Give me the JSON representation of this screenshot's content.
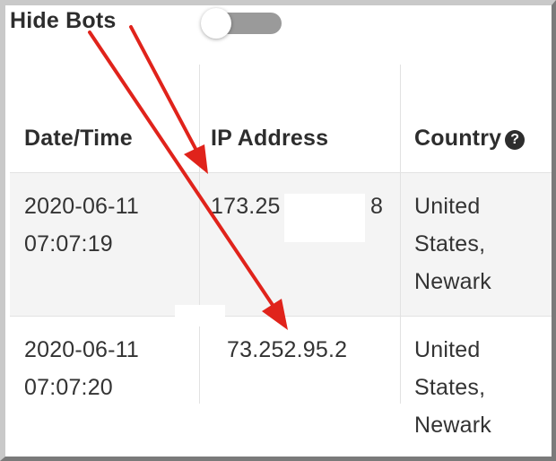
{
  "filter": {
    "label": "Hide Bots",
    "toggle_state": "off"
  },
  "table": {
    "columns": [
      "Date/Time",
      "IP Address",
      "Country"
    ],
    "country_help_icon": "question-circle-icon",
    "rows": [
      {
        "date": "2020-06-11",
        "time": "07:07:19",
        "ip_start": "173.25",
        "ip_end": "8",
        "country_lines": [
          "United",
          "States,",
          "Newark"
        ]
      },
      {
        "date": "2020-06-11",
        "time": "07:07:20",
        "ip": "73.252.95.2",
        "country_lines": [
          "United",
          "States,",
          "Newark"
        ]
      }
    ]
  },
  "annotation": {
    "arrow_color": "#e0231b"
  }
}
